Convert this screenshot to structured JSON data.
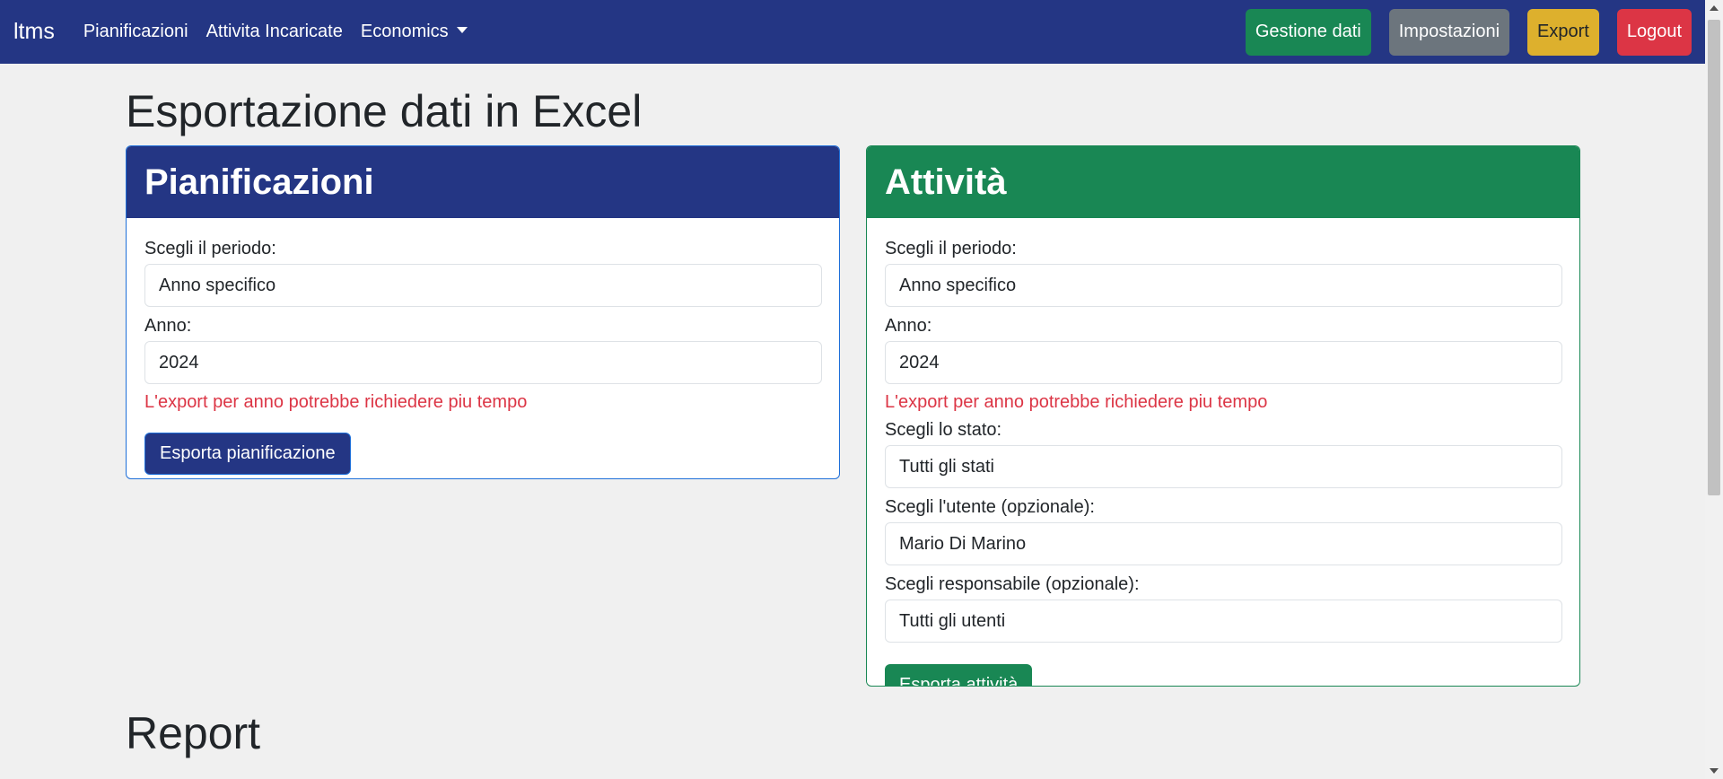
{
  "navbar": {
    "brand": "ltms",
    "links": [
      "Pianificazioni",
      "Attivita Incaricate",
      "Economics"
    ],
    "buttons": {
      "gestione": "Gestione dati",
      "impostazioni": "Impostazioni",
      "export": "Export",
      "logout": "Logout"
    }
  },
  "page_title": "Esportazione dati in Excel",
  "pianificazioni": {
    "title": "Pianificazioni",
    "periodo_label": "Scegli il periodo:",
    "periodo_value": "Anno specifico",
    "anno_label": "Anno:",
    "anno_value": "2024",
    "warning": "L'export per anno potrebbe richiedere piu tempo",
    "button": "Esporta pianificazione"
  },
  "attivita": {
    "title": "Attività",
    "periodo_label": "Scegli il periodo:",
    "periodo_value": "Anno specifico",
    "anno_label": "Anno:",
    "anno_value": "2024",
    "warning": "L'export per anno potrebbe richiedere piu tempo",
    "stato_label": "Scegli lo stato:",
    "stato_value": "Tutti gli stati",
    "utente_label": "Scegli l'utente (opzionale):",
    "utente_value": "Mario Di Marino",
    "responsabile_label": "Scegli responsabile (opzionale):",
    "responsabile_value": "Tutti gli utenti",
    "button": "Esporta attività"
  },
  "report_title": "Report",
  "colors": {
    "primary": "#243684",
    "success": "#198754",
    "danger": "#dc3545",
    "warning": "#ddb02d",
    "secondary": "#6c757d"
  }
}
